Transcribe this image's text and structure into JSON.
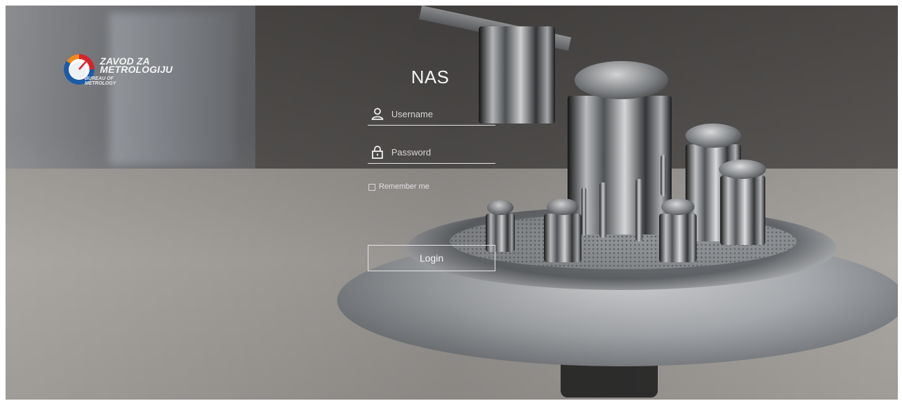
{
  "logo": {
    "title": "ZAVOD ZA\nMETROLOGIJU",
    "subtitle": "BUREAU OF\nMETROLOGY",
    "icon": "gauge-logo-icon",
    "colors": {
      "orange": "#f08a1c",
      "red": "#d9232a",
      "blue": "#1c5aa8"
    }
  },
  "login": {
    "app_title": "NAS",
    "username": {
      "icon": "user-icon",
      "placeholder": "Username",
      "value": ""
    },
    "password": {
      "icon": "lock-icon",
      "placeholder": "Password",
      "value": ""
    },
    "remember_label": "Remember me",
    "remember_checked": false,
    "submit_label": "Login"
  }
}
